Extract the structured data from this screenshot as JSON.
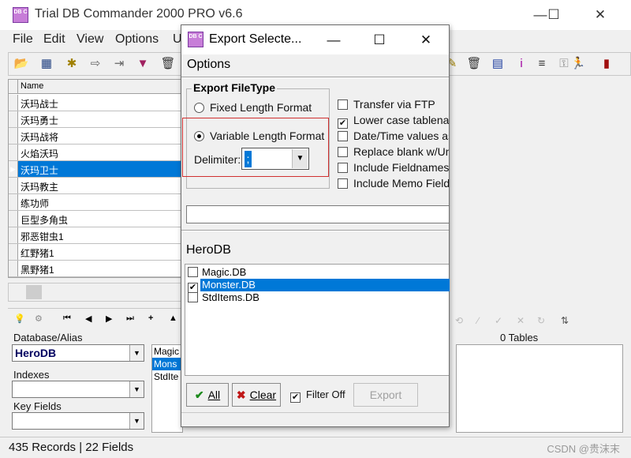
{
  "app": {
    "icon_text": "DB C",
    "title": "Trial DB Commander 2000 PRO v6.6",
    "window_buttons": [
      "—",
      "☐",
      "✕"
    ]
  },
  "menu": {
    "file": "File",
    "edit": "Edit",
    "view": "View",
    "options": "Options",
    "utilities_partial": "U"
  },
  "grid": {
    "column": "Name",
    "rows": [
      "沃玛战士",
      "沃玛勇士",
      "沃玛战将",
      "火焰沃玛",
      "沃玛卫士",
      "沃玛教主",
      "练功师",
      "巨型多角虫",
      "邪恶钳虫1",
      "红野猪1",
      "黑野猪1"
    ],
    "selected_index": 4,
    "current_marker": "▶"
  },
  "bottom": {
    "database_label": "Database/Alias",
    "database_value": "HeroDB",
    "indexes_label": "Indexes",
    "keyfields_label": "Key Fields",
    "tables_partial": [
      "Magic",
      "Mons",
      "StdIte"
    ],
    "tables_count": "0 Tables"
  },
  "status": {
    "text": "435 Records | 22 Fields",
    "watermark": "CSDN @贵沫末"
  },
  "dialog": {
    "icon_text": "DB C",
    "title": "Export Selecte...",
    "buttons": [
      "—",
      "☐",
      "✕"
    ],
    "menu": "Options",
    "filetype_group": "Export FileType",
    "fixed_label": "Fixed Length Format",
    "variable_label": "Variable Length Format",
    "variable_selected": true,
    "delimiter_label": "Delimiter:",
    "delimiter_value": ";",
    "checkboxes": [
      {
        "label": "Transfer via FTP",
        "checked": false
      },
      {
        "label": "Lower case tablenar",
        "checked": true
      },
      {
        "label": "Date/Time values as",
        "checked": false
      },
      {
        "label": "Replace blank w/Un",
        "checked": false
      },
      {
        "label": "Include Fieldnames",
        "checked": false
      },
      {
        "label": "Include Memo Fields",
        "checked": false
      }
    ],
    "path_value": "",
    "db_name": "HeroDB",
    "tables": [
      {
        "name": "Magic.DB",
        "checked": false,
        "selected": false
      },
      {
        "name": "Monster.DB",
        "checked": true,
        "selected": true
      },
      {
        "name": "StdItems.DB",
        "checked": false,
        "selected": false
      }
    ],
    "all_button": "All",
    "clear_button": "Clear",
    "filter_label": "Filter Off",
    "filter_checked": true,
    "export_button": "Export"
  }
}
